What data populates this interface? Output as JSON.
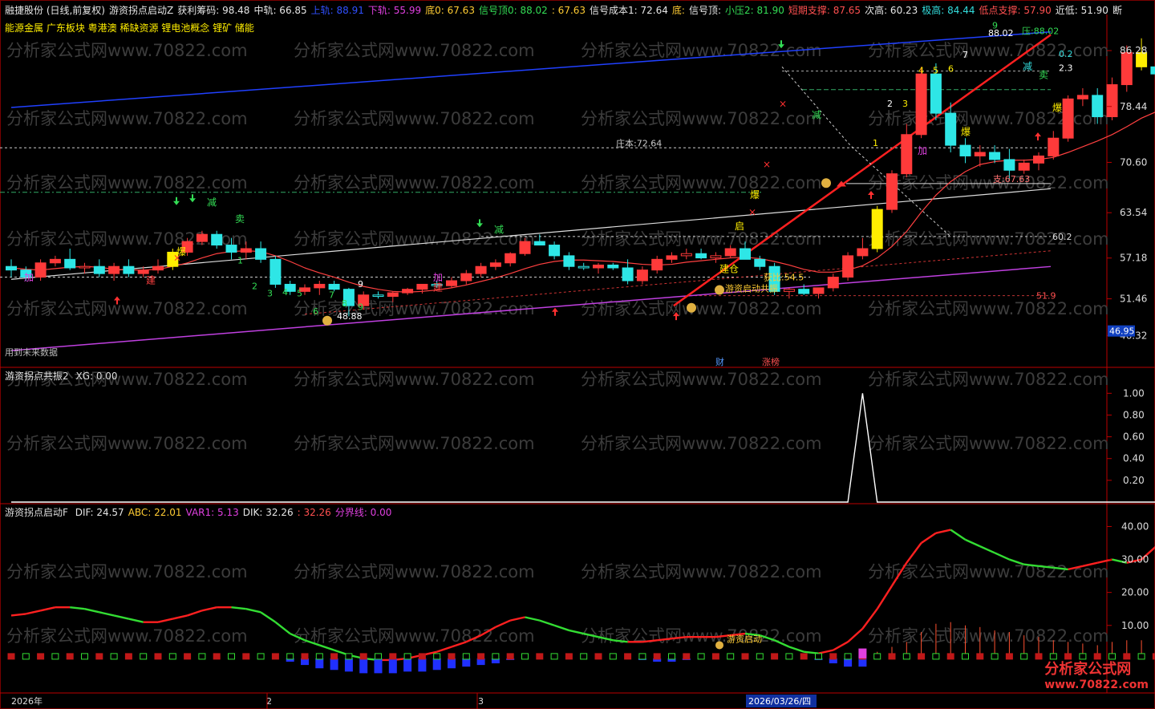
{
  "header": {
    "main_items": [
      {
        "text": "融捷股份 (日线,前复权)",
        "color": "#e6e6e6"
      },
      {
        "text": "游资拐点启动Z",
        "color": "#e6e6e6"
      },
      {
        "text": "获利筹码: 98.48",
        "color": "#e6e6e6"
      },
      {
        "text": "中轨: 66.85",
        "color": "#e6e6e6"
      },
      {
        "text": "上轨: 88.91",
        "color": "#3050ff"
      },
      {
        "text": "下轨: 55.99",
        "color": "#e040e0"
      },
      {
        "text": "底0: 67.63",
        "color": "#ffcc33"
      },
      {
        "text": "信号顶0: 88.02",
        "color": "#33dd55"
      },
      {
        "text": ": 67.63",
        "color": "#ffcc33"
      },
      {
        "text": "信号成本1: 72.64",
        "color": "#e6e6e6"
      },
      {
        "text": "底:",
        "color": "#ffcc33"
      },
      {
        "text": "信号顶:",
        "color": "#e6e6e6"
      },
      {
        "text": "小压2: 81.90",
        "color": "#33dd55"
      },
      {
        "text": "短期支撑: 87.65",
        "color": "#ff5050"
      },
      {
        "text": "次高: 60.23",
        "color": "#e6e6e6"
      },
      {
        "text": "极高: 84.44",
        "color": "#33dddd"
      },
      {
        "text": "低点支撑: 57.90",
        "color": "#ff5050"
      },
      {
        "text": "近低: 51.90",
        "color": "#e6e6e6"
      },
      {
        "text": "断",
        "color": "#e6e6e6"
      }
    ],
    "concepts": "能源金属 广东板块 粤港澳 稀缺资源 锂电池概念 锂矿 储能"
  },
  "panels": {
    "p1_footer": "用到未来数据",
    "p2_title": "游资拐点共振2",
    "p2_value": "XG: 0.00",
    "p3_title": "游资拐点启动F",
    "p3_values": [
      {
        "text": "DIF: 24.57",
        "color": "#e6e6e6"
      },
      {
        "text": "ABC: 22.01",
        "color": "#ffcc33"
      },
      {
        "text": "VAR1: 5.13",
        "color": "#e040e0"
      },
      {
        "text": "DIK: 32.26",
        "color": "#e6e6e6"
      },
      {
        "text": ": 32.26",
        "color": "#ff5050"
      },
      {
        "text": "分界线: 0.00",
        "color": "#e040e0"
      }
    ]
  },
  "watermark": "分析家公式网www.70822.com",
  "brand": {
    "name": "分析家公式网",
    "url": "www.70822.com"
  },
  "x_axis": {
    "labels": [
      "2026年",
      "2",
      "3",
      "2026/03/26/四"
    ]
  },
  "markers": {
    "cai": "财",
    "zhangting": "涨榜",
    "jian": "减",
    "jia": "加",
    "mai": "卖",
    "bao": "爆",
    "jian_cang": "建",
    "jiancang": "建仓",
    "qi": "启",
    "zhuangben": "庄本:72.64",
    "zhi": "支:67.63",
    "ratio": "获比:54.5",
    "resonance": "游资启动共振",
    "start": "游资启动",
    "val_6020": "60.2",
    "val_519": "51.9",
    "val_4888": "48.88",
    "val_8802": "88.02",
    "ya": "压:88.02",
    "val_02": "0.2",
    "val_23": "2.3"
  },
  "colors": {
    "up": "#ff3a3a",
    "down": "#2ee6e6",
    "flat": "#ffffff",
    "yellow": "#ffee00",
    "ma": "#ff4040",
    "upper": "#2040ff",
    "lower": "#c040e0"
  },
  "chart_data": [
    {
      "type": "candlestick",
      "title": "融捷股份 (日线,前复权)",
      "ylim": [
        45,
        90
      ],
      "y_ticks": [
        86.28,
        78.44,
        70.6,
        63.54,
        57.18,
        51.46,
        46.32
      ],
      "last_price": 46.95,
      "series": [
        {
          "name": "bars",
          "ohlc": [
            [
              56,
              57,
              54.5,
              55.5
            ],
            [
              55.5,
              56,
              54,
              54.5
            ],
            [
              54.5,
              57,
              54,
              56.5
            ],
            [
              56.5,
              57.5,
              56,
              57
            ],
            [
              57,
              58.5,
              55.5,
              55.8
            ],
            [
              55.8,
              56.5,
              55,
              56
            ],
            [
              56,
              57,
              54.5,
              55
            ],
            [
              55,
              56.5,
              54,
              56
            ],
            [
              56,
              57,
              54.5,
              55
            ],
            [
              55,
              56,
              54.5,
              55.5
            ],
            [
              55.5,
              57,
              55,
              56
            ],
            [
              56,
              58.5,
              55.5,
              58
            ],
            [
              58,
              60,
              57.5,
              59.5
            ],
            [
              59.5,
              61,
              59,
              60.5
            ],
            [
              60.5,
              61,
              58.5,
              59
            ],
            [
              59,
              60,
              57,
              58
            ],
            [
              58,
              59.5,
              57,
              58.5
            ],
            [
              58.5,
              59.5,
              56.5,
              57
            ],
            [
              57,
              57.5,
              53,
              53.5
            ],
            [
              53.5,
              54,
              52,
              52.5
            ],
            [
              52.5,
              53.5,
              52,
              53
            ],
            [
              53,
              54,
              52,
              53.5
            ],
            [
              53.5,
              54,
              52.5,
              52.8
            ],
            [
              52.8,
              53,
              49,
              50.5
            ],
            [
              50.5,
              52.5,
              50,
              52
            ],
            [
              52,
              52.5,
              51.5,
              51.8
            ],
            [
              51.8,
              52.5,
              51,
              52.3
            ],
            [
              52.3,
              53,
              52,
              52.8
            ],
            [
              52.8,
              53.5,
              52.2,
              53.5
            ],
            [
              53.5,
              54,
              53,
              53.3
            ],
            [
              53.3,
              54.5,
              53,
              54
            ],
            [
              54,
              55.5,
              53.5,
              55
            ],
            [
              55,
              56.5,
              54.5,
              56
            ],
            [
              56,
              57,
              55.5,
              56.5
            ],
            [
              56.5,
              58,
              56,
              57.8
            ],
            [
              57.8,
              60,
              57.5,
              59.5
            ],
            [
              59.5,
              60.5,
              59,
              59
            ],
            [
              59,
              59.5,
              57,
              57.5
            ],
            [
              57.5,
              58,
              55.5,
              56
            ],
            [
              56,
              56.5,
              55.5,
              55.8
            ],
            [
              55.8,
              56.5,
              55,
              56.2
            ],
            [
              56.2,
              56.5,
              55.5,
              55.8
            ],
            [
              55.8,
              57,
              53.5,
              54
            ],
            [
              54,
              56,
              53.5,
              55.5
            ],
            [
              55.5,
              57.5,
              55,
              57
            ],
            [
              57,
              58,
              56.5,
              57.5
            ],
            [
              57.5,
              58.5,
              57,
              57.8
            ],
            [
              57.8,
              58.5,
              57,
              57.2
            ],
            [
              57.2,
              58,
              56.5,
              57.5
            ],
            [
              57.5,
              59,
              57.2,
              58.5
            ],
            [
              58.5,
              59.5,
              57,
              57
            ],
            [
              57,
              57.5,
              55.5,
              56
            ],
            [
              56,
              56.5,
              52,
              52.5
            ],
            [
              52.5,
              53,
              51.5,
              52.8
            ],
            [
              52.8,
              53.5,
              52,
              52.2
            ],
            [
              52.2,
              53,
              51.5,
              53
            ],
            [
              53,
              55,
              52.5,
              54.5
            ],
            [
              54.5,
              58,
              54,
              57.5
            ],
            [
              57.5,
              60,
              57,
              58.5
            ],
            [
              58.5,
              64.5,
              58,
              64
            ],
            [
              64,
              69.5,
              63.5,
              69
            ],
            [
              69,
              76,
              68.5,
              74.5
            ],
            [
              74.5,
              84,
              74,
              83
            ],
            [
              83,
              84.5,
              76.5,
              77.5
            ],
            [
              77.5,
              79,
              72,
              73
            ],
            [
              73,
              74,
              70.5,
              71.5
            ],
            [
              71.5,
              73,
              70,
              72
            ],
            [
              72,
              73,
              70.5,
              71
            ],
            [
              71,
              72.5,
              68,
              69.5
            ],
            [
              69.5,
              71,
              69,
              70.5
            ],
            [
              70.5,
              72,
              69.5,
              71.5
            ],
            [
              71.5,
              75,
              71,
              74
            ],
            [
              74,
              80,
              73.5,
              79.5
            ],
            [
              79.5,
              81,
              78.5,
              80
            ],
            [
              80,
              81,
              76,
              77
            ],
            [
              77,
              82.5,
              76.5,
              81.5
            ],
            [
              81.5,
              87,
              80.5,
              86
            ],
            [
              86,
              88,
              83.5,
              84
            ],
            [
              84,
              85,
              82,
              83
            ],
            [
              83,
              84.5,
              81.5,
              82
            ],
            [
              82,
              83.5,
              80.5,
              80
            ],
            [
              80,
              87,
              79.5,
              86.5
            ]
          ]
        },
        {
          "name": "MA",
          "values": [
            55.8,
            55.6,
            55.5,
            55.7,
            55.9,
            56,
            55.9,
            55.6,
            55.5,
            55.5,
            55.6,
            56,
            56.5,
            57.2,
            57.8,
            58.1,
            58.2,
            58.1,
            57.5,
            56.7,
            55.8,
            55.1,
            54.5,
            53.8,
            53.2,
            52.8,
            52.5,
            52.4,
            52.5,
            52.7,
            53,
            53.4,
            53.9,
            54.4,
            55,
            55.7,
            56.3,
            56.7,
            56.9,
            56.9,
            56.8,
            56.7,
            56.5,
            56.3,
            56.2,
            56.3,
            56.6,
            56.8,
            57,
            57.2,
            57.3,
            57.1,
            56.7,
            56.2,
            55.6,
            55.2,
            55.2,
            55.5,
            56.1,
            57.2,
            58.8,
            60.9,
            63.6,
            66,
            67.9,
            69.3,
            70.3,
            70.7,
            70.9,
            70.9,
            71,
            71.3,
            72,
            72.8,
            73.6,
            74.5,
            75.6,
            76.8,
            77.7,
            78.3,
            78.6,
            79.1
          ]
        }
      ]
    },
    {
      "type": "line",
      "title": "游资拐点共振2",
      "ylim": [
        0,
        1.15
      ],
      "y_ticks": [
        1.0,
        0.8,
        0.6,
        0.4,
        0.2
      ],
      "series": [
        {
          "name": "XG",
          "values": [
            0,
            0,
            0,
            0,
            0,
            0,
            0,
            0,
            0,
            0,
            0,
            0,
            0,
            0,
            0,
            0,
            0,
            0,
            0,
            0,
            0,
            0,
            0,
            0,
            0,
            0,
            0,
            0,
            0,
            0,
            0,
            0,
            0,
            0,
            0,
            0,
            0,
            0,
            0,
            0,
            0,
            0,
            0,
            0,
            0,
            0,
            0,
            0,
            0,
            0,
            0,
            0,
            0,
            0,
            0,
            0,
            0,
            0,
            1,
            0,
            0,
            0,
            0,
            0,
            0,
            0,
            0,
            0,
            0,
            0,
            0,
            0,
            0,
            0,
            0,
            0,
            0,
            0,
            0,
            0,
            0,
            0
          ]
        }
      ]
    },
    {
      "type": "line",
      "title": "游资拐点启动F",
      "ylim": [
        -10,
        44
      ],
      "y_ticks": [
        40.0,
        30.0,
        20.0,
        10.0
      ],
      "series": [
        {
          "name": "DIK",
          "values": [
            13,
            13.5,
            14.5,
            15.5,
            15.5,
            15,
            14,
            13,
            12,
            11,
            11,
            12,
            13,
            14.5,
            15.5,
            15.5,
            15,
            14,
            11,
            7.5,
            5.5,
            4,
            2.5,
            1,
            0,
            -0.5,
            -0.5,
            0,
            1,
            2,
            3.5,
            5,
            7,
            9.5,
            11.5,
            12.5,
            11.5,
            10,
            8.5,
            7.5,
            6.5,
            5.5,
            5,
            5,
            5.5,
            6,
            6.5,
            6.5,
            6.5,
            7,
            7.5,
            7,
            5.5,
            3.5,
            2,
            1.5,
            2.5,
            5,
            9,
            15,
            22,
            29,
            35,
            38,
            39,
            36,
            34,
            32,
            30,
            28.5,
            28,
            27.5,
            27,
            28,
            29,
            30,
            29,
            30,
            34,
            35,
            34,
            33
          ]
        },
        {
          "name": "VAR1",
          "values": [
            0.5,
            0.5,
            0.5,
            0.5,
            0.5,
            0.5,
            0.5,
            0.5,
            0.5,
            0.5,
            0.5,
            0.5,
            0.5,
            0.5,
            0.5,
            0.5,
            0.5,
            0.5,
            0,
            -1,
            -2,
            -3,
            -3.5,
            -4,
            -4.5,
            -4.5,
            -4.5,
            -4,
            -4,
            -3.5,
            -3,
            -2.5,
            -2,
            -1.5,
            -0.5,
            0.5,
            0.5,
            0.5,
            0.5,
            0.5,
            0.5,
            0.5,
            0.5,
            -0.5,
            -1,
            -1,
            -0.5,
            0.5,
            0.5,
            0.5,
            0.5,
            0.5,
            0.5,
            0.5,
            0.5,
            -0.5,
            -1.5,
            -2.5,
            -2.5,
            2,
            3.5,
            5,
            8,
            10.5,
            11,
            10,
            9.5,
            8.5,
            8,
            7,
            6.5,
            5.5,
            5,
            4.5,
            4,
            5,
            5.5,
            5.5,
            4.5,
            4,
            3.5,
            4.5
          ]
        }
      ]
    }
  ]
}
